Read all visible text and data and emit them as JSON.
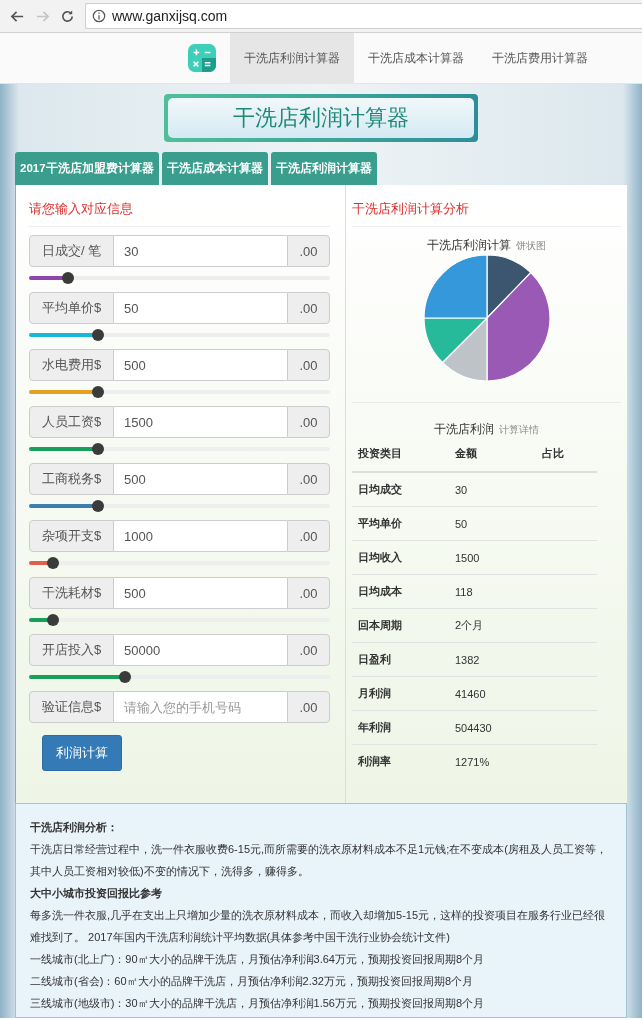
{
  "browser": {
    "url": "www.ganxijsq.com"
  },
  "nav": {
    "items": [
      {
        "label": "干洗店利润计算器",
        "selected": true
      },
      {
        "label": "干洗店成本计算器",
        "selected": false
      },
      {
        "label": "干洗店费用计算器",
        "selected": false
      }
    ]
  },
  "banner": {
    "title": "干洗店利润计算器"
  },
  "tabs": [
    {
      "label": "2017干洗店加盟费计算器"
    },
    {
      "label": "干洗店成本计算器"
    },
    {
      "label": "干洗店利润计算器"
    }
  ],
  "form": {
    "heading": "请您输入对应信息",
    "rows": [
      {
        "label": "日成交/ 笔",
        "value": "30",
        "suffix": ".00",
        "level": 0.13,
        "color": "#8e44ad"
      },
      {
        "label": "平均单价$",
        "value": "50",
        "suffix": ".00",
        "level": 0.23,
        "color": "#1ab8d8"
      },
      {
        "label": "水电费用$",
        "value": "500",
        "suffix": ".00",
        "level": 0.23,
        "color": "#e8a020"
      },
      {
        "label": "人员工资$",
        "value": "1500",
        "suffix": ".00",
        "level": 0.23,
        "color": "#16a05a"
      },
      {
        "label": "工商税务$",
        "value": "500",
        "suffix": ".00",
        "level": 0.23,
        "color": "#3a7fae"
      },
      {
        "label": "杂项开支$",
        "value": "1000",
        "suffix": ".00",
        "level": 0.08,
        "color": "#e0604f"
      },
      {
        "label": "干洗耗材$",
        "value": "500",
        "suffix": ".00",
        "level": 0.08,
        "color": "#16a05a"
      },
      {
        "label": "开店投入$",
        "value": "50000",
        "suffix": ".00",
        "level": 0.32,
        "color": "#16a05a"
      },
      {
        "label": "验证信息$",
        "placeholder": "请输入您的手机号码",
        "suffix": ".00"
      }
    ],
    "button": "利润计算"
  },
  "analysis": {
    "heading": "干洗店利润计算分析",
    "pie": {
      "title": "干洗店利润计算",
      "subtitle": "饼状图"
    },
    "table": {
      "title": "干洗店利润",
      "subtitle": "计算详情",
      "columns": [
        "投资类目",
        "金额",
        "占比"
      ],
      "rows": [
        [
          "日均成交",
          "30"
        ],
        [
          "平均单价",
          "50"
        ],
        [
          "日均收入",
          "1500"
        ],
        [
          "日均成本",
          "118"
        ],
        [
          "回本周期",
          "2个月"
        ],
        [
          "日盈利",
          "1382"
        ],
        [
          "月利润",
          "41460"
        ],
        [
          "年利润",
          "504430"
        ],
        [
          "利润率",
          "1271%"
        ]
      ]
    }
  },
  "notes": [
    {
      "kind": "heading",
      "text": "干洗店利润分析："
    },
    {
      "kind": "paragraph",
      "text": "干洗店日常经营过程中，洗一件衣服收费6-15元,而所需要的洗衣原材料成本不足1元钱;在不变成本(房租及人员工资等，其中人员工资相对较低)不变的情况下，洗得多，赚得多。"
    },
    {
      "kind": "heading",
      "text": "大中小城市投资回报比参考"
    },
    {
      "kind": "paragraph",
      "text": "每多洗一件衣服,几乎在支出上只增加少量的洗衣原材料成本，而收入却增加5-15元，这样的投资项目在服务行业已经很难找到了。 2017年国内干洗店利润统计平均数据(具体参考中国干洗行业协会统计文件)"
    },
    {
      "kind": "paragraph",
      "text": "一线城市(北上广)：90㎡大小的品牌干洗店，月预估净利润3.64万元，预期投资回报周期8个月"
    },
    {
      "kind": "paragraph",
      "text": "二线城市(省会)：60㎡大小的品牌干洗店，月预估净利润2.32万元，预期投资回报周期8个月"
    },
    {
      "kind": "paragraph",
      "text": "三线城市(地级市)：30㎡大小的品牌干洗店，月预估净利润1.56万元，预期投资回报周期8个月"
    }
  ]
}
